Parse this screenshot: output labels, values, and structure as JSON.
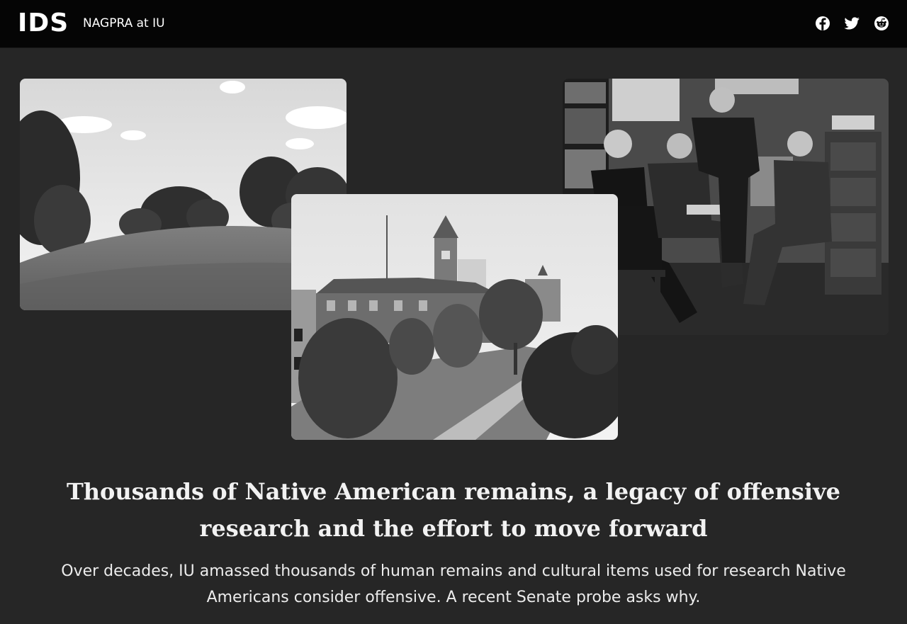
{
  "header": {
    "logo_text": "IDS",
    "site_title": "NAGPRA at IU",
    "social": [
      {
        "icon": "facebook-icon",
        "label": "Facebook"
      },
      {
        "icon": "twitter-icon",
        "label": "Twitter"
      },
      {
        "icon": "reddit-icon",
        "label": "Reddit"
      }
    ]
  },
  "gallery": {
    "photos": [
      {
        "name": "mound-landscape-photo",
        "subject": "grassy mound with trees under cloudy sky (black and white)"
      },
      {
        "name": "campus-building-photo",
        "subject": "campus building with clock tower, trees and walkway (black and white)"
      },
      {
        "name": "researchers-group-photo",
        "subject": "four men posed in an office with bookshelves and filing cabinets (black and white)"
      }
    ]
  },
  "article": {
    "headline": "Thousands of Native American remains, a legacy of offensive research and the effort to move forward",
    "dek": "Over decades, IU amassed thousands of human remains and cultural items used for research Native Americans consider offensive. A recent Senate probe asks why."
  },
  "colors": {
    "header_bg": "#050505",
    "page_bg": "#262626",
    "text": "#f2f2f2"
  }
}
